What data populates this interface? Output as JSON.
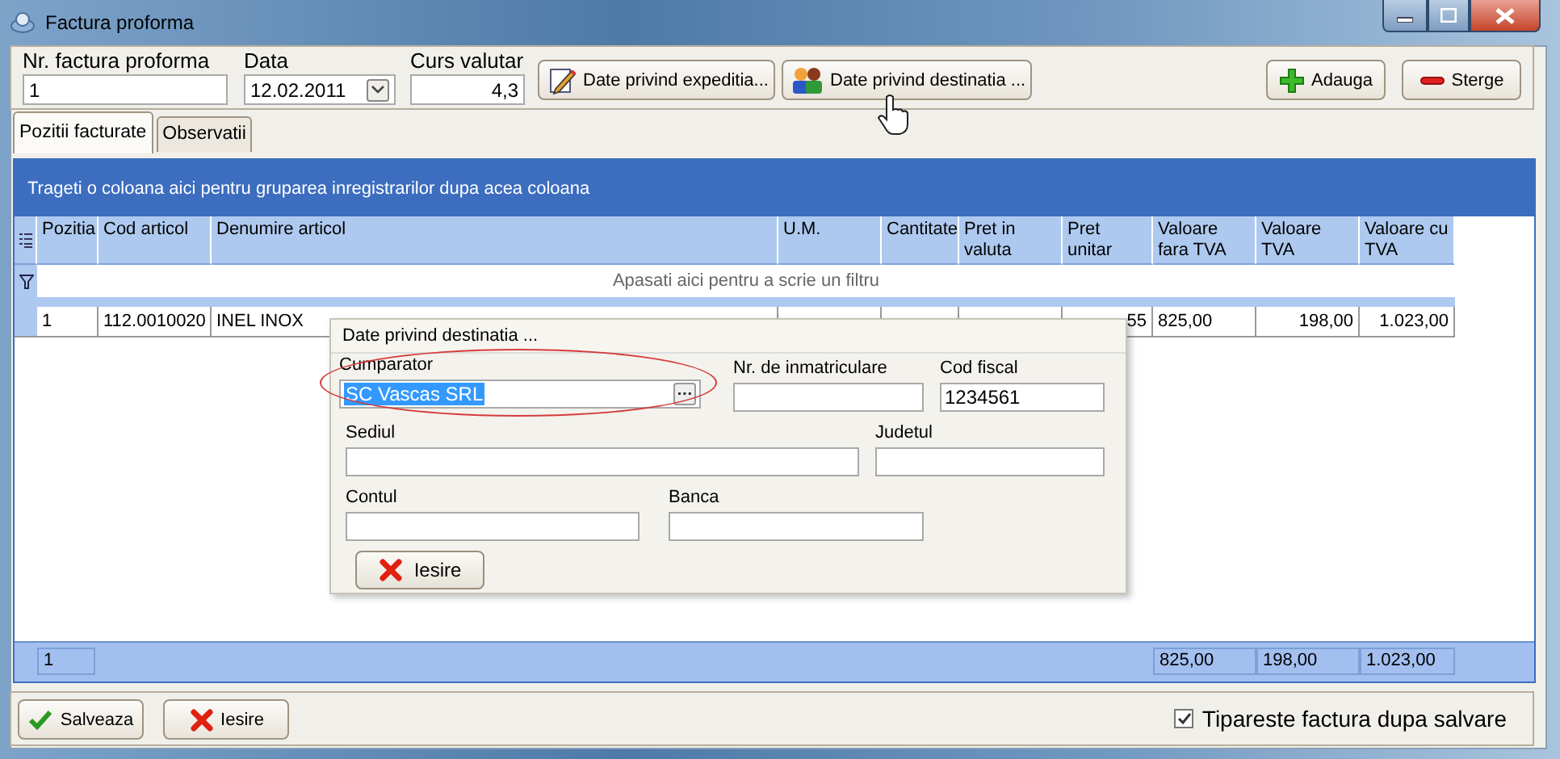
{
  "window": {
    "title": "Factura proforma"
  },
  "header_fields": [
    {
      "label": "Nr. factura proforma",
      "value": "1",
      "kind": "text"
    },
    {
      "label": "Data",
      "value": "12.02.2011",
      "kind": "date"
    },
    {
      "label": "Curs valutar",
      "value": "4,3",
      "kind": "number"
    }
  ],
  "toolbar_buttons": [
    {
      "label": "Date privind expeditia...",
      "kind": "edit"
    },
    {
      "label": "Date privind destinatia ...",
      "kind": "people"
    }
  ],
  "action_buttons": [
    {
      "label": "Adauga",
      "kind": "add"
    },
    {
      "label": "Sterge",
      "kind": "remove"
    }
  ],
  "tabs": [
    {
      "label": "Pozitii facturate",
      "selected": true
    },
    {
      "label": "Observatii",
      "selected": false
    }
  ],
  "grid": {
    "group_hint": "Trageti o coloana aici pentru gruparea inregistrarilor dupa acea coloana",
    "filter_hint": "Apasati aici pentru a scrie un filtru",
    "columns": [
      {
        "label": "Pozitia",
        "row_value": "1",
        "total": "1"
      },
      {
        "label": "Cod articol",
        "row_value": "112.0010020"
      },
      {
        "label": "Denumire articol",
        "row_value": "INEL INOX"
      },
      {
        "label": "U.M."
      },
      {
        "label": "Cantitate"
      },
      {
        "label": "Pret in valuta"
      },
      {
        "label": "Pret unitar",
        "row_value": "55"
      },
      {
        "label": "Valoare fara TVA",
        "row_value": "825,00",
        "total": "825,00"
      },
      {
        "label": "Valoare TVA",
        "row_value": "198,00",
        "total": "198,00"
      },
      {
        "label": "Valoare cu TVA",
        "row_value": "1.023,00",
        "total": "1.023,00"
      }
    ]
  },
  "popup": {
    "title": "Date privind destinatia ...",
    "fields": [
      {
        "label": "Cumparator",
        "value": "SC Vascas SRL",
        "kind": "lookup",
        "circled": true,
        "text_selected": true
      },
      {
        "label": "Nr. de inmatriculare",
        "kind": "text"
      },
      {
        "label": "Cod fiscal",
        "value": "1234561",
        "kind": "text"
      },
      {
        "label": "Sediul",
        "kind": "text"
      },
      {
        "label": "Judetul",
        "kind": "text"
      },
      {
        "label": "Contul",
        "kind": "text"
      },
      {
        "label": "Banca",
        "kind": "text"
      }
    ],
    "close_button": {
      "label": "Iesire",
      "kind": "close"
    }
  },
  "bottom_buttons": [
    {
      "label": "Salveaza",
      "kind": "save"
    },
    {
      "label": "Iesire",
      "kind": "close"
    }
  ],
  "print_option": {
    "label": "Tipareste factura dupa salvare",
    "checked": true
  }
}
